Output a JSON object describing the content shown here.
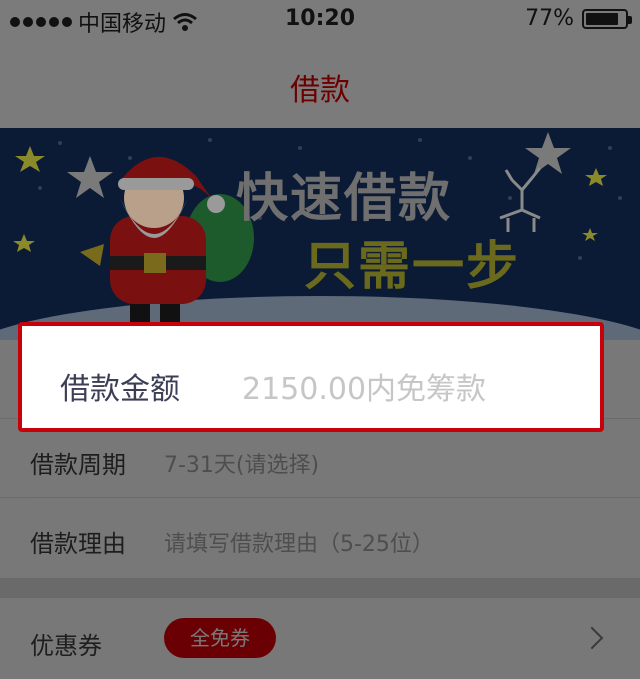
{
  "status_bar": {
    "carrier": "中国移动",
    "time": "10:20",
    "battery_percent": "77%",
    "battery_level": 0.77,
    "icons": [
      "signal-dots-icon",
      "wifi-icon",
      "battery-icon"
    ]
  },
  "nav": {
    "title": "借款"
  },
  "banner": {
    "headline_line1": "快速借款",
    "headline_line2": "只需一步",
    "icons": [
      "santa-claus-icon",
      "reindeer-icon",
      "star-icon"
    ]
  },
  "form": {
    "amount": {
      "label": "借款金额",
      "value": "2150.00内免筹款"
    },
    "period": {
      "label": "借款周期",
      "placeholder": "7-31天(请选择)"
    },
    "reason": {
      "label": "借款理由",
      "placeholder": "请填写借款理由（5-25位）"
    }
  },
  "coupon": {
    "label": "优惠券",
    "badge": "全免券",
    "icon": "chevron-right-icon"
  },
  "colors": {
    "accent": "#c8000a",
    "overlay": "#6d6d6d",
    "banner_bg": "#0a1a33"
  }
}
